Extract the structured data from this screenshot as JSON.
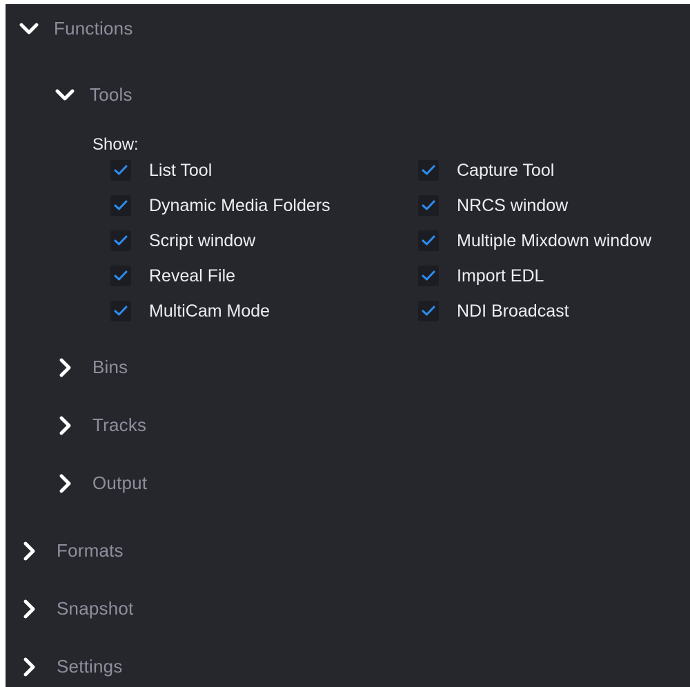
{
  "colors": {
    "panel_bg": "#26272d",
    "checkbox_bg": "#1c1d22",
    "check_accent": "#2d8cf0",
    "section_text": "#8e8f9c",
    "item_text": "#eeeef1"
  },
  "functions": {
    "label": "Functions",
    "icon": "chevron-down-icon",
    "expanded": true,
    "tools": {
      "label": "Tools",
      "icon": "chevron-down-icon",
      "expanded": true,
      "show_label": "Show:",
      "left_column": [
        {
          "label": "List Tool",
          "checked": true
        },
        {
          "label": "Dynamic Media Folders",
          "checked": true
        },
        {
          "label": "Script window",
          "checked": true
        },
        {
          "label": "Reveal File",
          "checked": true
        },
        {
          "label": "MultiCam Mode",
          "checked": true
        }
      ],
      "right_column": [
        {
          "label": "Capture Tool",
          "checked": true
        },
        {
          "label": "NRCS window",
          "checked": true
        },
        {
          "label": "Multiple Mixdown window",
          "checked": true
        },
        {
          "label": "Import EDL",
          "checked": true
        },
        {
          "label": "NDI Broadcast",
          "checked": true
        }
      ]
    },
    "bins": {
      "label": "Bins",
      "icon": "chevron-right-icon",
      "expanded": false
    },
    "tracks": {
      "label": "Tracks",
      "icon": "chevron-right-icon",
      "expanded": false
    },
    "output": {
      "label": "Output",
      "icon": "chevron-right-icon",
      "expanded": false
    }
  },
  "formats": {
    "label": "Formats",
    "icon": "chevron-right-icon",
    "expanded": false
  },
  "snapshot": {
    "label": "Snapshot",
    "icon": "chevron-right-icon",
    "expanded": false
  },
  "settings": {
    "label": "Settings",
    "icon": "chevron-right-icon",
    "expanded": false
  }
}
